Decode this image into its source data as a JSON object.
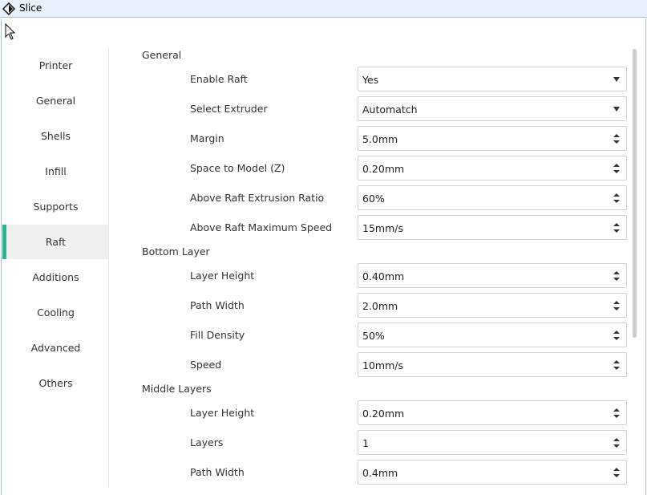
{
  "window": {
    "title": "Slice"
  },
  "sidebar": {
    "items": [
      {
        "label": "Printer",
        "active": false
      },
      {
        "label": "General",
        "active": false
      },
      {
        "label": "Shells",
        "active": false
      },
      {
        "label": "Infill",
        "active": false
      },
      {
        "label": "Supports",
        "active": false
      },
      {
        "label": "Raft",
        "active": true
      },
      {
        "label": "Additions",
        "active": false
      },
      {
        "label": "Cooling",
        "active": false
      },
      {
        "label": "Advanced",
        "active": false
      },
      {
        "label": "Others",
        "active": false
      }
    ]
  },
  "sections": [
    {
      "title": "General",
      "fields": [
        {
          "label": "Enable Raft",
          "value": "Yes",
          "control": "dropdown"
        },
        {
          "label": "Select Extruder",
          "value": "Automatch",
          "control": "dropdown"
        },
        {
          "label": "Margin",
          "value": "5.0mm",
          "control": "spinbox"
        },
        {
          "label": "Space to Model (Z)",
          "value": "0.20mm",
          "control": "spinbox"
        },
        {
          "label": "Above Raft Extrusion Ratio",
          "value": "60%",
          "control": "spinbox"
        },
        {
          "label": "Above Raft Maximum Speed",
          "value": "15mm/s",
          "control": "spinbox"
        }
      ]
    },
    {
      "title": "Bottom Layer",
      "fields": [
        {
          "label": "Layer Height",
          "value": "0.40mm",
          "control": "spinbox"
        },
        {
          "label": "Path Width",
          "value": "2.0mm",
          "control": "spinbox"
        },
        {
          "label": "Fill Density",
          "value": "50%",
          "control": "spinbox"
        },
        {
          "label": "Speed",
          "value": "10mm/s",
          "control": "spinbox"
        }
      ]
    },
    {
      "title": "Middle Layers",
      "fields": [
        {
          "label": "Layer Height",
          "value": "0.20mm",
          "control": "spinbox"
        },
        {
          "label": "Layers",
          "value": "1",
          "control": "spinbox"
        },
        {
          "label": "Path Width",
          "value": "0.4mm",
          "control": "spinbox"
        }
      ]
    }
  ],
  "colors": {
    "accent": "#27b68b",
    "active_bg": "#f0f0f0",
    "titlebar_bg": "#e8f1fb"
  },
  "icons": {
    "app": "app-diamond-icon",
    "cursor": "mouse-cursor-icon",
    "dropdown": "chevron-down-icon",
    "spinner": "spinner-arrows-icon"
  }
}
